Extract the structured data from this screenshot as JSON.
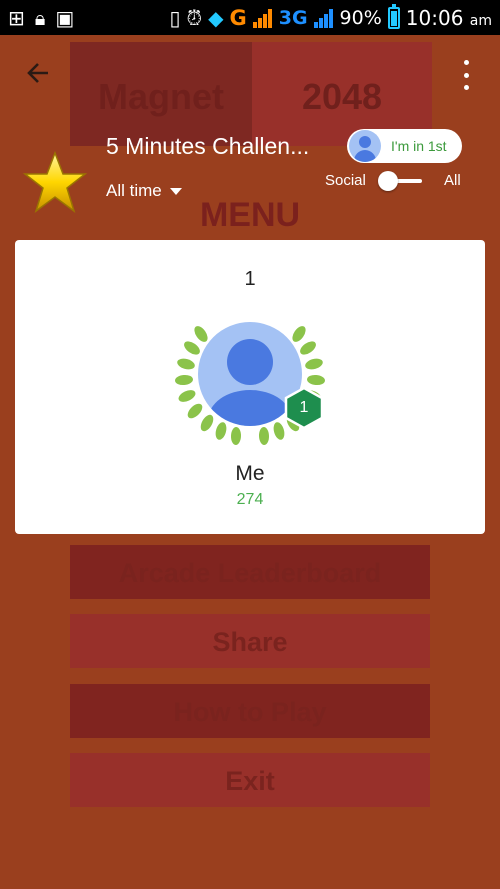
{
  "status_bar": {
    "battery_percent": "90%",
    "time": "10:06",
    "ampm": "am",
    "network_g": "G",
    "network_3g": "3G",
    "icons": [
      "plus-box-icon",
      "lock-icon",
      "image-icon",
      "vibrate-icon",
      "alarm-icon",
      "wifi-icon",
      "signal-icon",
      "battery-icon"
    ]
  },
  "background_game": {
    "tile_left": "Magnet",
    "tile_right": "2048",
    "menu_title": "MENU",
    "buttons": [
      "Arcade Leaderboard",
      "Share",
      "How to Play",
      "Exit"
    ]
  },
  "leaderboard": {
    "title": "5 Minutes Challen...",
    "time_filter": "All time",
    "rank_pill_text": "I'm in 1st",
    "toggle_left": "Social",
    "toggle_right": "All",
    "toggle_selected": "Social"
  },
  "entry": {
    "rank": "1",
    "name": "Me",
    "score": "274",
    "badge": "1"
  },
  "colors": {
    "background": "#9a3f1e",
    "card": "#ffffff",
    "score_green": "#4caf50",
    "badge_green": "#1e8e4e",
    "laurel_green": "#8bc34a",
    "avatar_blue": "#4a79e0",
    "avatar_bg": "#a4c2f4"
  }
}
